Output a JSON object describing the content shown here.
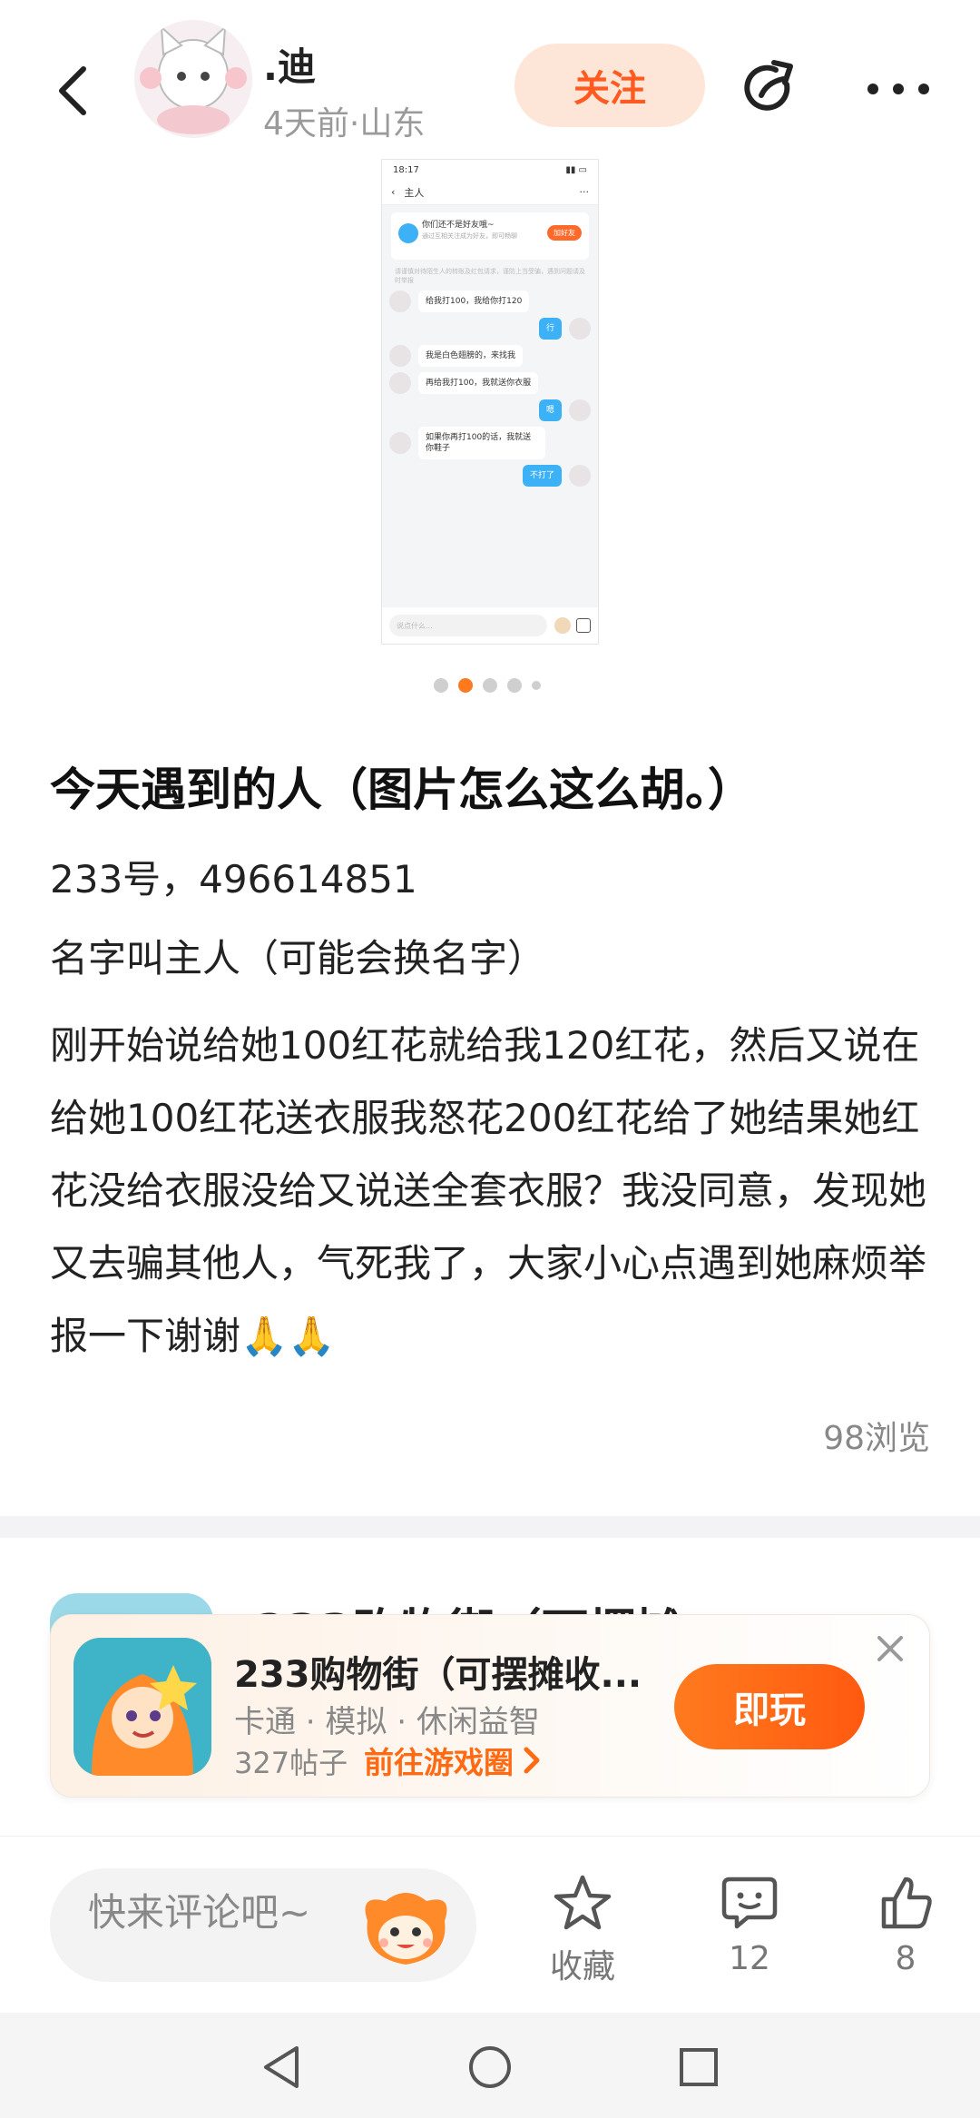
{
  "header": {
    "username": ".迪",
    "meta": "4天前·山东",
    "follow_label": "关注"
  },
  "screenshot": {
    "status_time": "18:17",
    "chat_title": "主人",
    "notice_title": "你们还不是好友哦~",
    "notice_sub": "通过互相关注成为好友，即可畅聊",
    "notice_btn": "加好友",
    "warning": "请谨慎对待陌生人的转账及红包请求，谨防上当受骗，遇到问题请及时举报",
    "messages": [
      {
        "from": "other",
        "text": "给我打100，我给你打120"
      },
      {
        "from": "me",
        "text": "行"
      },
      {
        "from": "other",
        "text": "我是白色翅膀的，来找我"
      },
      {
        "from": "other",
        "text": "再给我打100，我就送你衣服"
      },
      {
        "from": "me",
        "text": "嗯"
      },
      {
        "from": "other",
        "text": "如果你再打100的话，我就送你鞋子"
      },
      {
        "from": "me",
        "text": "不打了"
      }
    ],
    "input_placeholder": "说点什么..."
  },
  "pager": {
    "count": 5,
    "active": 1
  },
  "post": {
    "title": "今天遇到的人（图片怎么这么胡。）",
    "line1": "233号，496614851",
    "line2": "名字叫主人（可能会换名字）",
    "body": "刚开始说给她100红花就给我120红花，然后又说在给她100红花送衣服我怒花200红花给了她结果她红花没给衣服没给又说送全套衣服？我没同意，发现她又去骗其他人，气死我了，大家小心点遇到她麻烦举报一下谢谢🙏🙏",
    "views": "98浏览"
  },
  "game": {
    "bg_title": "233购物街（可摆摊",
    "name": "233购物街（可摆摊收...",
    "tags": "卡通 · 模拟 · 休闲益智",
    "posts": "327帖子",
    "link": "前往游戏圈",
    "play_label": "即玩"
  },
  "action_bar": {
    "comment_placeholder": "快来评论吧~",
    "favorite_label": "收藏",
    "comment_count": "12",
    "like_count": "8"
  },
  "colors": {
    "accent": "#ff6a13",
    "follow_bg": "#fde6d8",
    "chat_blue": "#3db1f5"
  },
  "icons": [
    "back-icon",
    "share-icon",
    "more-icon",
    "close-icon",
    "star-icon",
    "comment-icon",
    "thumbs-up-icon",
    "nav-back-icon",
    "nav-home-icon",
    "nav-recents-icon"
  ]
}
